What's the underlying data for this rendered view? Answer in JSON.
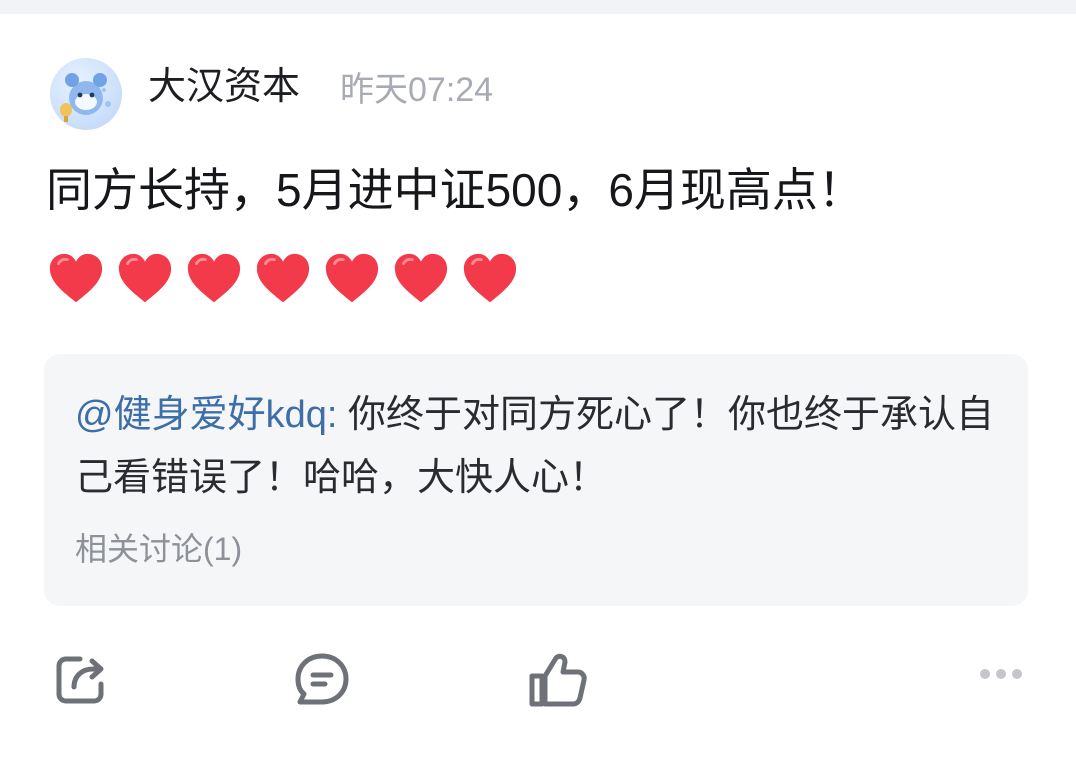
{
  "post": {
    "author": "大汉资本",
    "time": "昨天07:24",
    "content": "同方长持，5月进中证500，6月现高点！",
    "emoji_count": 7,
    "quote": {
      "mention": "@健身爱好kdq:",
      "text": " 你终于对同方死心了！你也终于承认自己看错误了！哈哈，大快人心！",
      "related": "相关讨论(1)"
    }
  },
  "actions": {
    "icons": [
      "share-icon",
      "comment-icon",
      "like-icon",
      "more-icon"
    ]
  },
  "colors": {
    "mention": "#3d6ea8",
    "time": "#a8abb3",
    "quote_bg": "#f5f6f8",
    "heart": "#f23a4b",
    "icon": "#6e7178"
  }
}
